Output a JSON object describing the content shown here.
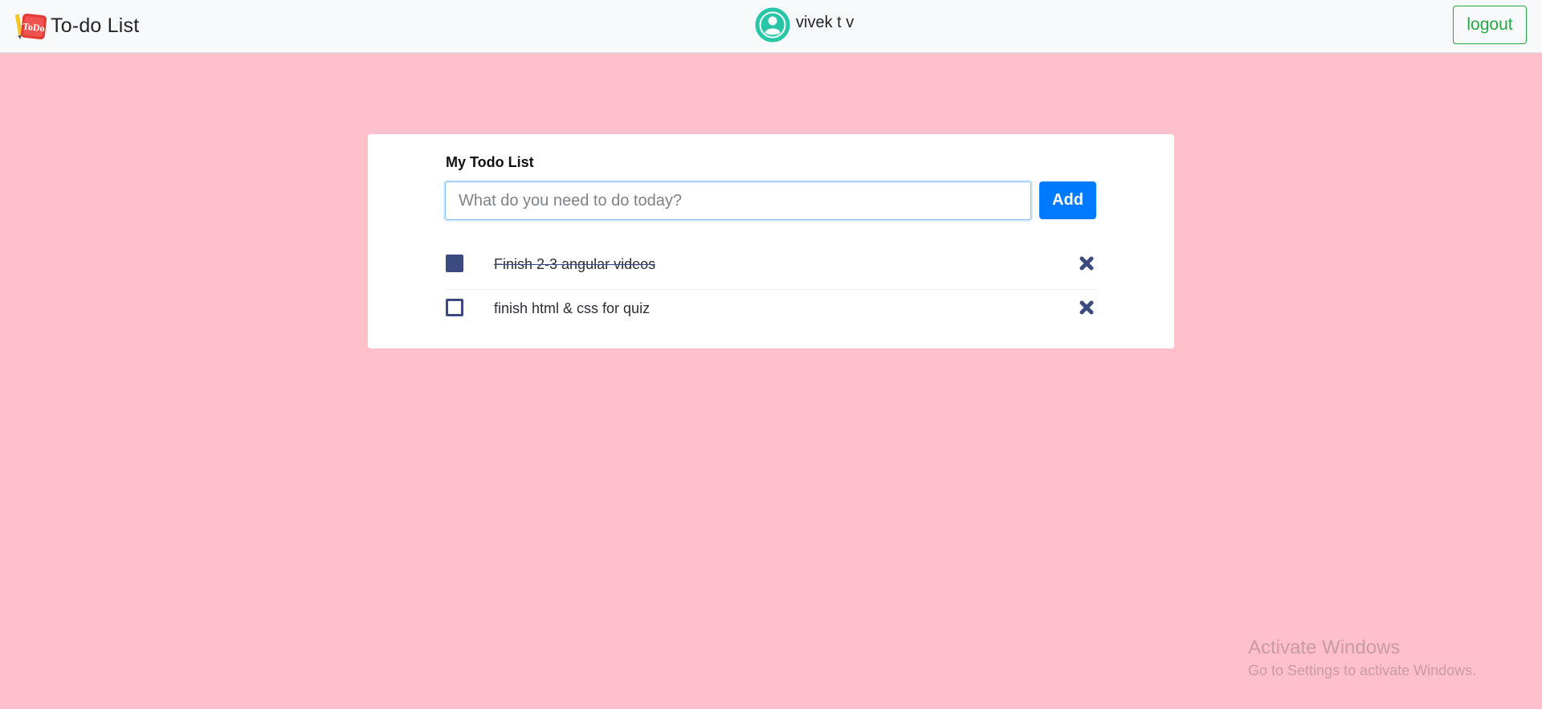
{
  "navbar": {
    "brand_logo_text": "ToDo",
    "brand_title": "To-do List",
    "user_name": "vivek t v",
    "logout_label": "logout"
  },
  "card": {
    "title": "My Todo List",
    "input_placeholder": "What do you need to do today?",
    "input_value": "",
    "add_label": "Add"
  },
  "todos": [
    {
      "text": "Finish 2-3 angular videos",
      "completed": true
    },
    {
      "text": "finish html & css for quiz",
      "completed": false
    }
  ],
  "watermark": {
    "title": "Activate Windows",
    "subtitle": "Go to Settings to activate Windows."
  },
  "colors": {
    "page_background": "#ffbfcb",
    "navbar_background": "#f8f9fa",
    "add_button": "#007bff",
    "logout_accent": "#28a745",
    "avatar_accent": "#26c6a6",
    "checkbox_accent": "#3b4b80"
  },
  "icons": {
    "brand": "todo-logo-icon",
    "user": "user-avatar-icon",
    "delete": "close-x-icon"
  }
}
